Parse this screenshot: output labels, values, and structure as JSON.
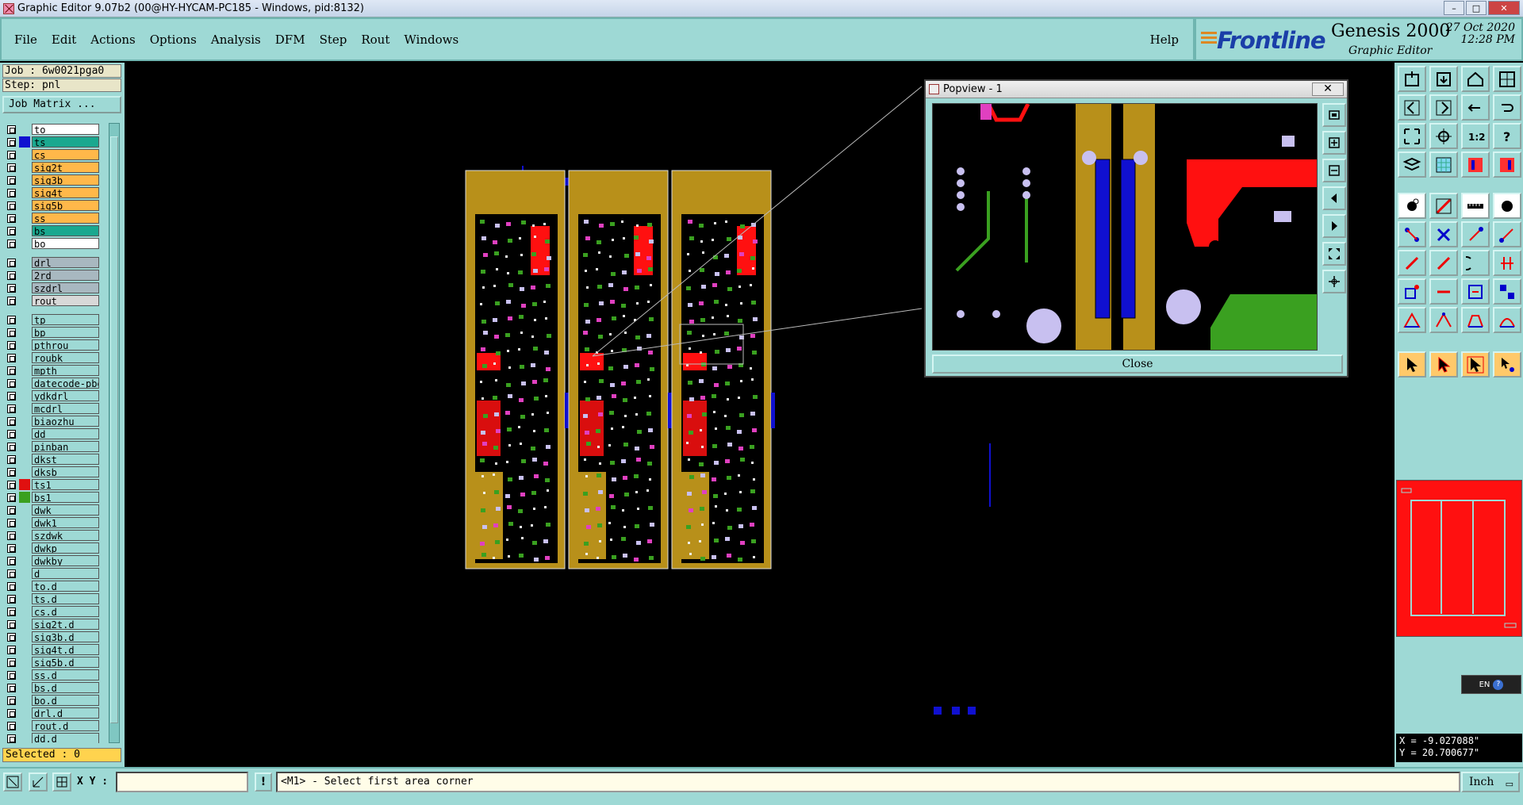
{
  "window": {
    "title": "Graphic Editor 9.07b2 (00@HY-HYCAM-PC185 - Windows, pid:8132)"
  },
  "menu": {
    "items": [
      "File",
      "Edit",
      "Actions",
      "Options",
      "Analysis",
      "DFM",
      "Step",
      "Rout",
      "Windows"
    ],
    "help": "Help"
  },
  "logo": {
    "brand": "Frontline",
    "product": "Genesis 2000",
    "subproduct": "Graphic Editor",
    "date": "27 Oct 2020",
    "time": "12:28 PM"
  },
  "left_panel": {
    "job": "Job : 6w0021pga0",
    "step": "Step: pnl",
    "job_matrix_label": "Job Matrix ...",
    "selected": "Selected : 0"
  },
  "layers": [
    {
      "name": "to",
      "color": "#ffffff",
      "swatch": "",
      "group_start": false
    },
    {
      "name": "ts",
      "color": "#1aa88f",
      "swatch": "#1010d0",
      "group_start": false
    },
    {
      "name": "cs",
      "color": "#ffb84a",
      "swatch": "",
      "group_start": false
    },
    {
      "name": "sig2t",
      "color": "#ffb84a",
      "swatch": "",
      "group_start": false
    },
    {
      "name": "sig3b",
      "color": "#ffb84a",
      "swatch": "",
      "group_start": false
    },
    {
      "name": "sig4t",
      "color": "#ffb84a",
      "swatch": "",
      "group_start": false
    },
    {
      "name": "sig5b",
      "color": "#ffb84a",
      "swatch": "",
      "group_start": false
    },
    {
      "name": "ss",
      "color": "#ffb84a",
      "swatch": "",
      "group_start": false
    },
    {
      "name": "bs",
      "color": "#1aa88f",
      "swatch": "",
      "group_start": false
    },
    {
      "name": "bo",
      "color": "#ffffff",
      "swatch": "",
      "group_start": false
    },
    {
      "name": "drl",
      "color": "#a8b8c0",
      "swatch": "",
      "group_start": true
    },
    {
      "name": "2rd",
      "color": "#a8b8c0",
      "swatch": "",
      "group_start": false
    },
    {
      "name": "szdrl",
      "color": "#a8b8c0",
      "swatch": "",
      "group_start": false
    },
    {
      "name": "rout",
      "color": "#d8d8d8",
      "swatch": "",
      "group_start": false
    },
    {
      "name": "tp",
      "color": "#9ed9d5",
      "swatch": "",
      "group_start": true
    },
    {
      "name": "bp",
      "color": "#9ed9d5",
      "swatch": "",
      "group_start": false
    },
    {
      "name": "pthrou",
      "color": "#9ed9d5",
      "swatch": "",
      "group_start": false
    },
    {
      "name": "roubk",
      "color": "#9ed9d5",
      "swatch": "",
      "group_start": false
    },
    {
      "name": "mpth",
      "color": "#9ed9d5",
      "swatch": "",
      "group_start": false
    },
    {
      "name": "datecode-pbe",
      "color": "#9ed9d5",
      "swatch": "",
      "group_start": false
    },
    {
      "name": "ydkdrl",
      "color": "#9ed9d5",
      "swatch": "",
      "group_start": false
    },
    {
      "name": "mcdrl",
      "color": "#9ed9d5",
      "swatch": "",
      "group_start": false
    },
    {
      "name": "biaozhu",
      "color": "#9ed9d5",
      "swatch": "",
      "group_start": false
    },
    {
      "name": "dd",
      "color": "#9ed9d5",
      "swatch": "",
      "group_start": false
    },
    {
      "name": "pinban",
      "color": "#9ed9d5",
      "swatch": "",
      "group_start": false
    },
    {
      "name": "dkst",
      "color": "#9ed9d5",
      "swatch": "",
      "group_start": false
    },
    {
      "name": "dksb",
      "color": "#9ed9d5",
      "swatch": "",
      "group_start": false
    },
    {
      "name": "ts1",
      "color": "#9ed9d5",
      "swatch": "#e01010",
      "group_start": false
    },
    {
      "name": "bs1",
      "color": "#9ed9d5",
      "swatch": "#3aa020",
      "group_start": false
    },
    {
      "name": "dwk",
      "color": "#9ed9d5",
      "swatch": "",
      "group_start": false
    },
    {
      "name": "dwk1",
      "color": "#9ed9d5",
      "swatch": "",
      "group_start": false
    },
    {
      "name": "szdwk",
      "color": "#9ed9d5",
      "swatch": "",
      "group_start": false
    },
    {
      "name": "dwkp",
      "color": "#9ed9d5",
      "swatch": "",
      "group_start": false
    },
    {
      "name": "dwkby",
      "color": "#9ed9d5",
      "swatch": "",
      "group_start": false
    },
    {
      "name": "d",
      "color": "#9ed9d5",
      "swatch": "",
      "group_start": false
    },
    {
      "name": "to.d",
      "color": "#9ed9d5",
      "swatch": "",
      "group_start": false
    },
    {
      "name": "ts.d",
      "color": "#9ed9d5",
      "swatch": "",
      "group_start": false
    },
    {
      "name": "cs.d",
      "color": "#9ed9d5",
      "swatch": "",
      "group_start": false
    },
    {
      "name": "sig2t.d",
      "color": "#9ed9d5",
      "swatch": "",
      "group_start": false
    },
    {
      "name": "sig3b.d",
      "color": "#9ed9d5",
      "swatch": "",
      "group_start": false
    },
    {
      "name": "sig4t.d",
      "color": "#9ed9d5",
      "swatch": "",
      "group_start": false
    },
    {
      "name": "sig5b.d",
      "color": "#9ed9d5",
      "swatch": "",
      "group_start": false
    },
    {
      "name": "ss.d",
      "color": "#9ed9d5",
      "swatch": "",
      "group_start": false
    },
    {
      "name": "bs.d",
      "color": "#9ed9d5",
      "swatch": "",
      "group_start": false
    },
    {
      "name": "bo.d",
      "color": "#9ed9d5",
      "swatch": "",
      "group_start": false
    },
    {
      "name": "drl.d",
      "color": "#9ed9d5",
      "swatch": "",
      "group_start": false
    },
    {
      "name": "rout.d",
      "color": "#9ed9d5",
      "swatch": "",
      "group_start": false
    },
    {
      "name": "dd.d",
      "color": "#9ed9d5",
      "swatch": "",
      "group_start": false
    }
  ],
  "popview": {
    "title": "Popview - 1",
    "close_label": "Close",
    "close_x": "✕"
  },
  "coords": {
    "x": "X = -9.027088\"",
    "y": "Y = 20.700677\""
  },
  "lang": "EN",
  "bottom": {
    "xy_label": "X Y :",
    "xy_value": "",
    "message_icon": "!",
    "message": "<M1> - Select first area corner",
    "units": "Inch"
  },
  "colors": {
    "panel": "#9ed9d5",
    "copper": "#b8901a",
    "signal_green": "#3aa020",
    "pad": "#c8c0f0",
    "red_layer": "#ff1010",
    "blue_layer": "#1010d0"
  }
}
